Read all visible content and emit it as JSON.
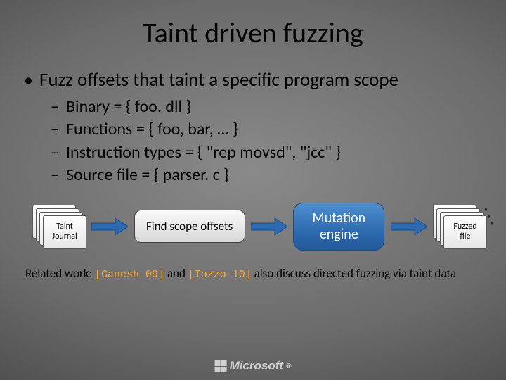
{
  "title": "Taint driven fuzzing",
  "bullets": {
    "main": "Fuzz offsets that taint a specific program scope",
    "sub1": "Binary = { foo. dll }",
    "sub2": "Functions = { foo, bar, … }",
    "sub3": "Instruction types = { \"rep movsd\", \"jcc\" }",
    "sub4": "Source file = { parser. c }"
  },
  "diagram": {
    "taint_l1": "Taint",
    "taint_l2": "Journal",
    "scope": "Find scope offsets",
    "mutation_l1": "Mutation",
    "mutation_l2": "engine",
    "fuzzed_l1": "Fuzzed",
    "fuzzed_l2": "file"
  },
  "related": {
    "pre": "Related work: ",
    "ref1": "[Ganesh 09]",
    "mid": " and ",
    "ref2": "[Iozzo 10]",
    "post": " also discuss directed fuzzing via taint data"
  },
  "brand": "Microsoft"
}
